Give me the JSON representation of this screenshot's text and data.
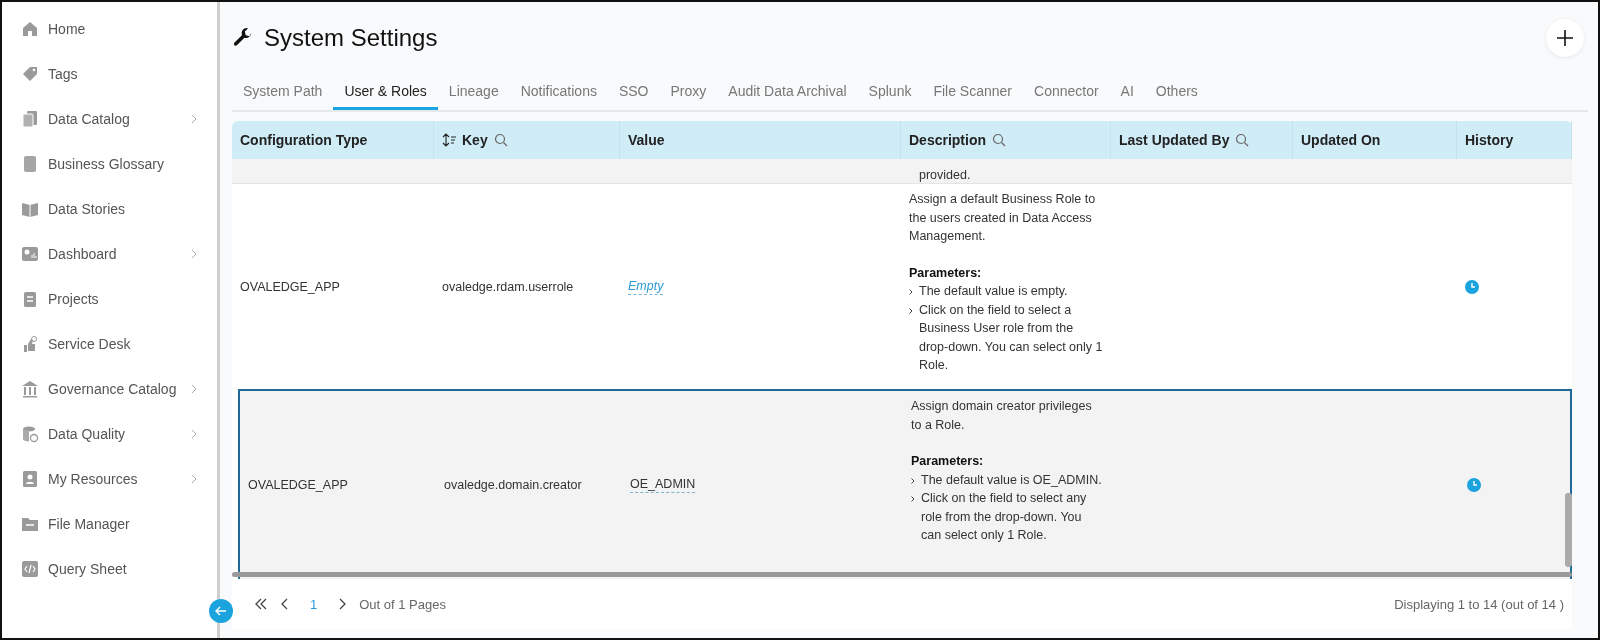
{
  "sidebar": {
    "items": [
      {
        "label": "Home",
        "has_submenu": false
      },
      {
        "label": "Tags",
        "has_submenu": false
      },
      {
        "label": "Data Catalog",
        "has_submenu": true
      },
      {
        "label": "Business Glossary",
        "has_submenu": false
      },
      {
        "label": "Data Stories",
        "has_submenu": false
      },
      {
        "label": "Dashboard",
        "has_submenu": true
      },
      {
        "label": "Projects",
        "has_submenu": false
      },
      {
        "label": "Service Desk",
        "has_submenu": false
      },
      {
        "label": "Governance Catalog",
        "has_submenu": true
      },
      {
        "label": "Data Quality",
        "has_submenu": true
      },
      {
        "label": "My Resources",
        "has_submenu": true
      },
      {
        "label": "File Manager",
        "has_submenu": false
      },
      {
        "label": "Query Sheet",
        "has_submenu": false
      }
    ]
  },
  "page": {
    "title": "System Settings"
  },
  "tabs": [
    {
      "label": "System Path",
      "selected": false
    },
    {
      "label": "User & Roles",
      "selected": true
    },
    {
      "label": "Lineage",
      "selected": false
    },
    {
      "label": "Notifications",
      "selected": false
    },
    {
      "label": "SSO",
      "selected": false
    },
    {
      "label": "Proxy",
      "selected": false
    },
    {
      "label": "Audit Data Archival",
      "selected": false
    },
    {
      "label": "Splunk",
      "selected": false
    },
    {
      "label": "File Scanner",
      "selected": false
    },
    {
      "label": "Connector",
      "selected": false
    },
    {
      "label": "AI",
      "selected": false
    },
    {
      "label": "Others",
      "selected": false
    }
  ],
  "table": {
    "columns": [
      {
        "label": "Configuration Type",
        "sortable": false,
        "searchable": false
      },
      {
        "label": "Key",
        "sortable": true,
        "searchable": true
      },
      {
        "label": "Value",
        "sortable": false,
        "searchable": false
      },
      {
        "label": "Description",
        "sortable": false,
        "searchable": true
      },
      {
        "label": "Last Updated By",
        "sortable": false,
        "searchable": true
      },
      {
        "label": "Updated On",
        "sortable": false,
        "searchable": false
      },
      {
        "label": "History",
        "sortable": false,
        "searchable": false
      }
    ],
    "rows": [
      {
        "kind": "fragment",
        "description": "provided."
      },
      {
        "kind": "setting",
        "selected": false,
        "configuration_type": "OVALEDGE_APP",
        "key": "ovaledge.rdam.userrole",
        "value": "Empty",
        "value_empty": true,
        "description": "Assign a default Business Role to the users created in Data Access Management.",
        "parameters_label": "Parameters:",
        "parameters": [
          "The default value is empty.",
          "Click on the field to select a Business User role from the drop-down. You can select only 1 Role."
        ]
      },
      {
        "kind": "setting",
        "selected": true,
        "configuration_type": "OVALEDGE_APP",
        "key": "ovaledge.domain.creator",
        "value": "OE_ADMIN",
        "value_empty": false,
        "description": "Assign domain creator privileges to a Role.",
        "parameters_label": "Parameters:",
        "parameters": [
          "The default value is OE_ADMIN.",
          "Click on the field to select any role from the drop-down. You can select only 1 Role."
        ]
      }
    ]
  },
  "pagination": {
    "page": "1",
    "pages_text": "Out of 1 Pages",
    "summary": "Displaying 1 to 14 (out of 14 )"
  }
}
